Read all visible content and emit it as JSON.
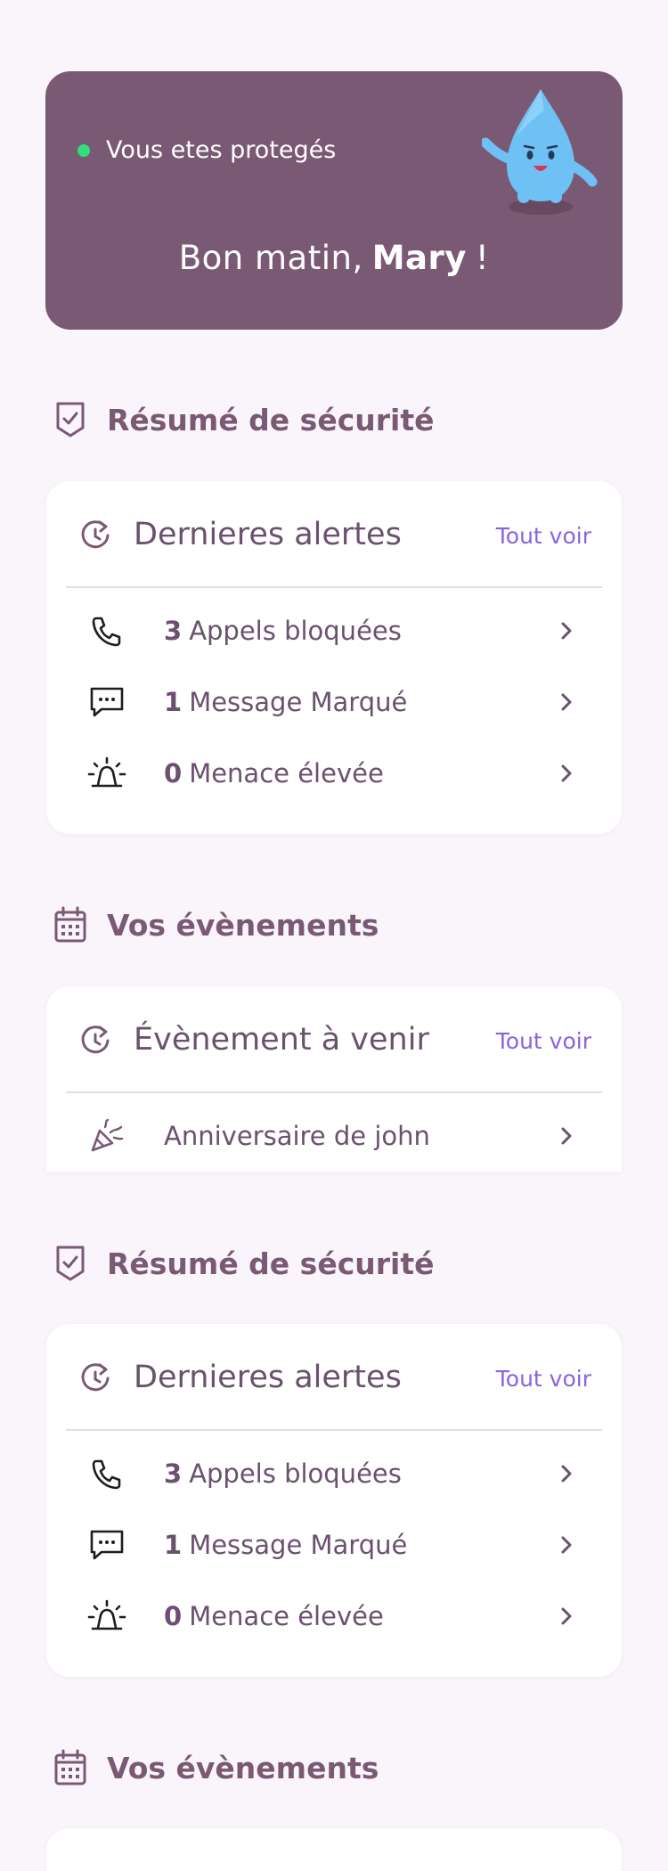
{
  "hero": {
    "status": "Vous etes protegés",
    "greeting_prefix": "Bon matin,",
    "user_name": "Mary",
    "greeting_suffix": "!"
  },
  "colors": {
    "brand": "#7a5974",
    "background": "#faf5fa",
    "accent_link": "#8a63e0",
    "status_ok": "#2fe07a"
  },
  "security1": {
    "title": "Résumé de sécurité",
    "card_title": "Dernieres alertes",
    "see_all": "Tout voir",
    "rows": [
      {
        "count": "3",
        "label": "Appels bloquées",
        "icon": "phone-icon"
      },
      {
        "count": "1",
        "label": "Message Marqué",
        "icon": "message-icon"
      },
      {
        "count": "0",
        "label": "Menace élevée",
        "icon": "siren-icon"
      }
    ]
  },
  "events1": {
    "title": "Vos évènements",
    "card_title": "Évènement à venir",
    "see_all": "Tout voir",
    "rows": [
      {
        "label": "Anniversaire de john",
        "icon": "party-popper-icon"
      }
    ]
  },
  "security2": {
    "title": "Résumé de sécurité",
    "card_title": "Dernieres alertes",
    "see_all": "Tout voir",
    "rows": [
      {
        "count": "3",
        "label": "Appels bloquées",
        "icon": "phone-icon"
      },
      {
        "count": "1",
        "label": "Message Marqué",
        "icon": "message-icon"
      },
      {
        "count": "0",
        "label": "Menace élevée",
        "icon": "siren-icon"
      }
    ]
  },
  "events2": {
    "title": "Vos évènements"
  }
}
